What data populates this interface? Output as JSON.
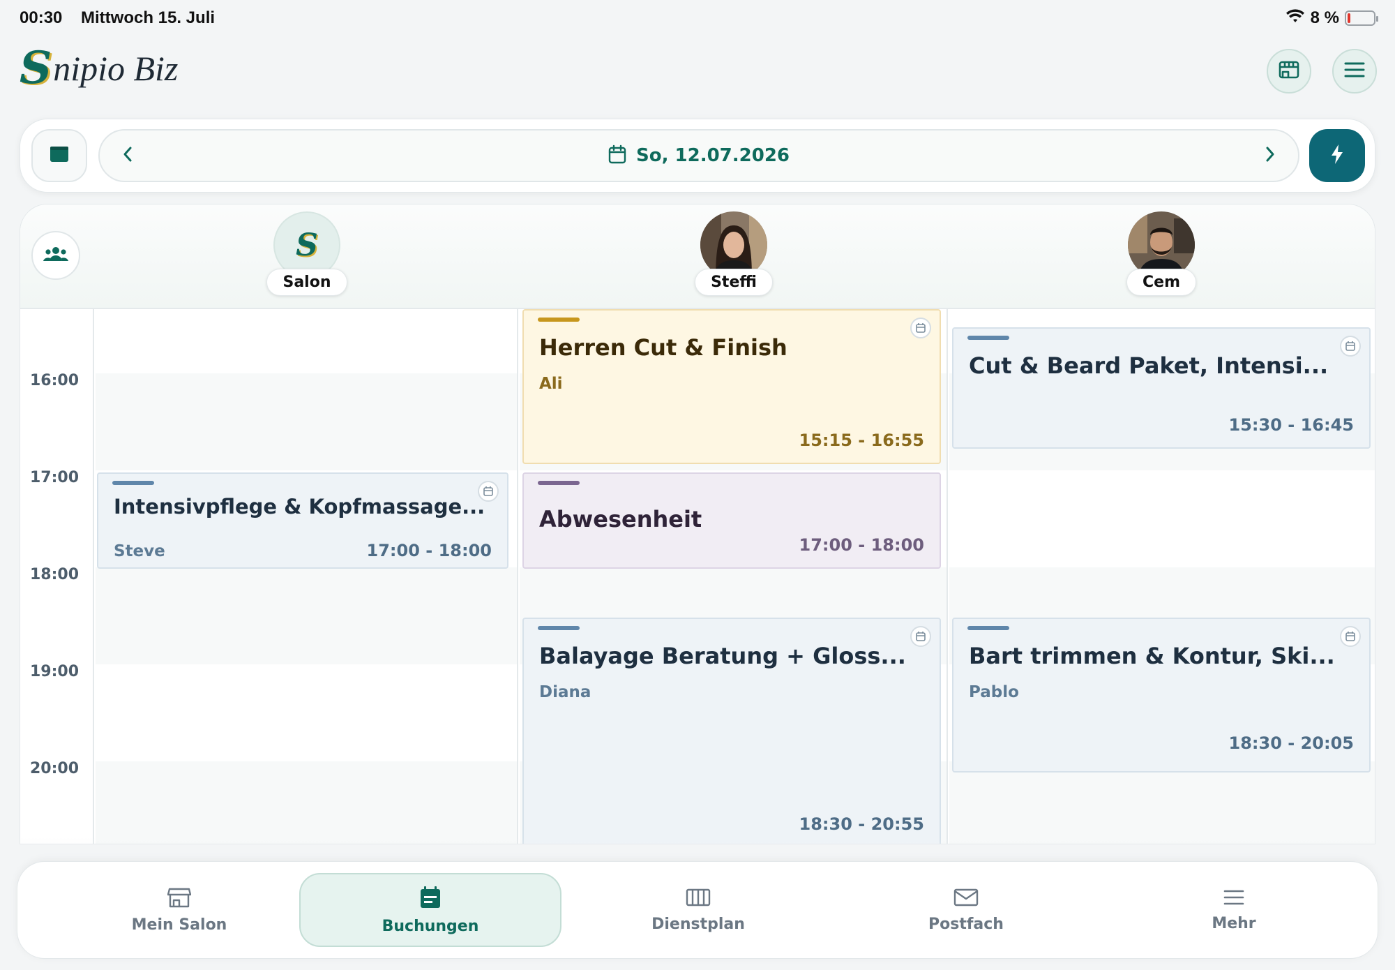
{
  "status_bar": {
    "time": "00:30",
    "date": "Mittwoch 15. Juli",
    "battery": "8 %"
  },
  "header": {
    "logo_initial": "S",
    "logo_rest": "nipio Biz",
    "store_icon": "store-icon",
    "menu_icon": "menu-icon"
  },
  "datebar": {
    "date_label": "So, 12.07.2026",
    "view_icon": "calendar-view-icon",
    "flash_icon": "lightning-icon"
  },
  "calendar": {
    "staff": [
      {
        "name": "Salon"
      },
      {
        "name": "Steffi"
      },
      {
        "name": "Cem"
      }
    ],
    "time_labels": [
      "16:00",
      "17:00",
      "18:00",
      "19:00",
      "20:00"
    ],
    "appointments": {
      "salon_1": {
        "title": "Intensivpflege & Kopfmassage...",
        "client": "Steve",
        "time": "17:00 - 18:00"
      },
      "steffi_1": {
        "title": "Herren Cut & Finish",
        "client": "Ali",
        "time": "15:15 - 16:55"
      },
      "steffi_2": {
        "title": "Abwesenheit",
        "time": "17:00 - 18:00"
      },
      "steffi_3": {
        "title": "Balayage Beratung + Gloss...",
        "client": "Diana",
        "time": "18:30 - 20:55"
      },
      "cem_1": {
        "title": "Cut & Beard Paket, Intensi...",
        "time": "15:30 - 16:45"
      },
      "cem_2": {
        "title": "Bart trimmen & Kontur, Ski...",
        "client": "Pablo",
        "time": "18:30 - 20:05"
      }
    }
  },
  "bottom_nav": {
    "items": [
      {
        "label": "Mein Salon",
        "icon": "store-icon"
      },
      {
        "label": "Buchungen",
        "icon": "calendar-icon",
        "active": true
      },
      {
        "label": "Dienstplan",
        "icon": "schedule-grid-icon"
      },
      {
        "label": "Postfach",
        "icon": "mail-icon"
      },
      {
        "label": "Mehr",
        "icon": "menu-icon"
      }
    ]
  },
  "colors": {
    "brand": "#0e6a5c",
    "accent_button": "#0d6776",
    "yellow_appt": "#fef7e3",
    "purple_appt": "#f1edf4",
    "blue_appt": "#eef3f7"
  }
}
